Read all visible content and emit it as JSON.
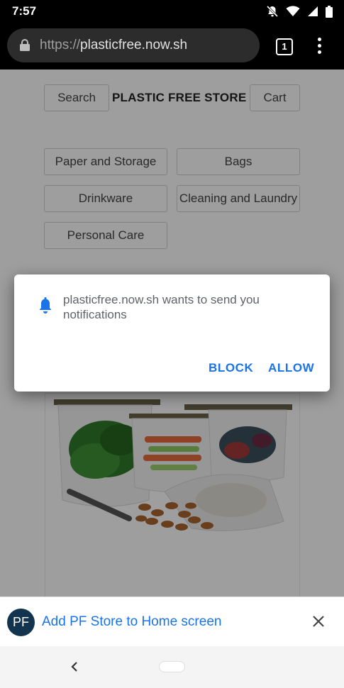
{
  "status_bar": {
    "time": "7:57"
  },
  "browser": {
    "url_scheme": "https://",
    "url_host": "plasticfree.now.sh",
    "tab_count": "1"
  },
  "store": {
    "search_label": "Search",
    "title": "PLASTIC FREE STORE",
    "cart_label": "Cart",
    "categories": [
      "Paper and Storage",
      "Bags",
      "Drinkware",
      "Cleaning and Laundry",
      "Personal Care"
    ]
  },
  "notification_dialog": {
    "message": "plasticfree.now.sh wants to send you notifications",
    "block_label": "BLOCK",
    "allow_label": "ALLOW"
  },
  "add_to_home": {
    "badge": "PF",
    "text": "Add PF Store to Home screen"
  },
  "colors": {
    "accent": "#1a73e8",
    "badge": "#12344f"
  }
}
